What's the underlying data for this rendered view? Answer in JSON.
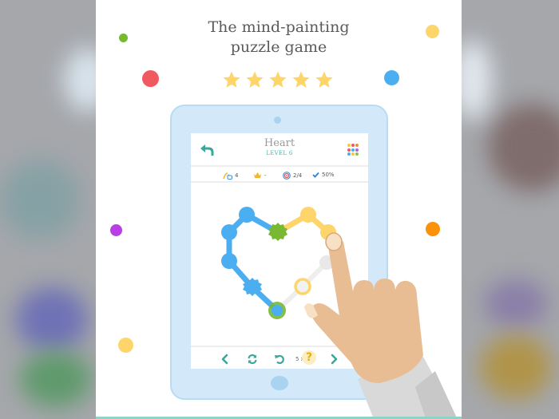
{
  "headline": {
    "line1": "The mind-painting",
    "line2": "puzzle game"
  },
  "rating": {
    "stars": 5,
    "max": 5,
    "color": "#fdd56a"
  },
  "decor_dots": [
    {
      "name": "green-dot",
      "color": "#78b833"
    },
    {
      "name": "red-dot",
      "color": "#f0595f"
    },
    {
      "name": "yellow-dot-top",
      "color": "#fdd56a"
    },
    {
      "name": "blue-dot",
      "color": "#4baef0"
    },
    {
      "name": "purple-dot",
      "color": "#b83fe6"
    },
    {
      "name": "orange-dot",
      "color": "#fc9209"
    },
    {
      "name": "yellow-dot-bottom",
      "color": "#fdd56a"
    }
  ],
  "game": {
    "title": "Heart",
    "level_label": "LEVEL 6",
    "accent": "#3aa79c",
    "back_icon": "back-arrow-icon",
    "menu_icon": "level-grid-icon",
    "grid_colors": [
      "#f7c73f",
      "#f05a5a",
      "#f08a3a",
      "#f05a5a",
      "#4baef0",
      "#b95ee6",
      "#4baef0",
      "#f7c73f",
      "#8bc34a"
    ],
    "stats": {
      "moves": "4",
      "crown": "-",
      "targets": "2/4",
      "progress": "50%"
    },
    "controls": {
      "prev_icon": "chevron-left-icon",
      "restart_icon": "refresh-icon",
      "undo_icon": "undo-icon",
      "hint_count": "5 x",
      "hint_label": "?",
      "next_icon": "chevron-right-icon"
    },
    "puzzle": {
      "colors": {
        "blue": "#4baef0",
        "yellow": "#fdd56a",
        "green": "#78b833",
        "empty": "#e8e8e8"
      }
    }
  }
}
